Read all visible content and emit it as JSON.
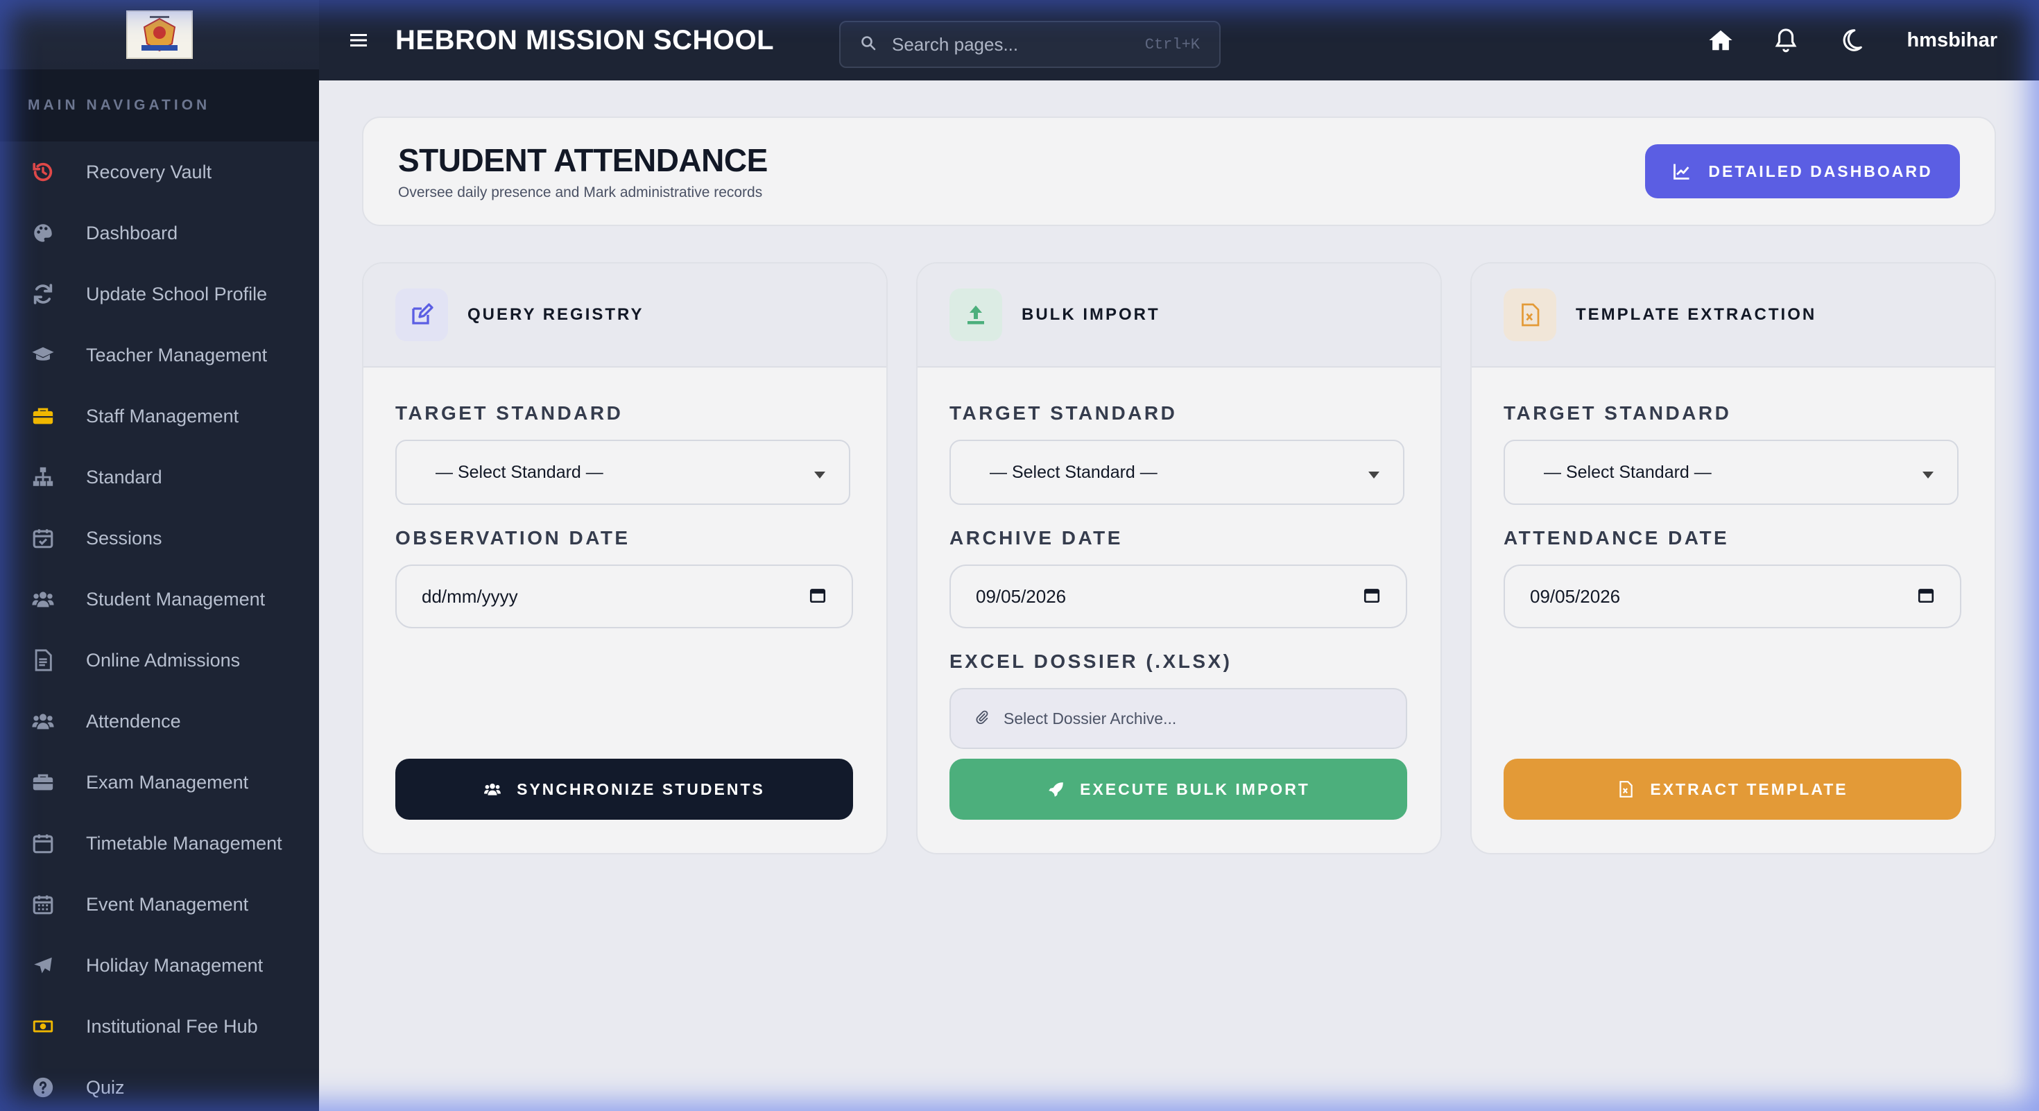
{
  "app": {
    "school_name": "HEBRON MISSION SCHOOL",
    "username": "hmsbihar"
  },
  "search": {
    "placeholder": "Search pages...",
    "shortcut": "Ctrl+K"
  },
  "sidebar": {
    "section_label": "MAIN NAVIGATION",
    "items": [
      {
        "label": "Recovery Vault",
        "icon": "history-icon",
        "color": "#e04848"
      },
      {
        "label": "Dashboard",
        "icon": "palette-icon",
        "color": "#8a93a8"
      },
      {
        "label": "Update School Profile",
        "icon": "sync-icon",
        "color": "#8a93a8"
      },
      {
        "label": "Teacher Management",
        "icon": "graduation-cap-icon",
        "color": "#8a93a8"
      },
      {
        "label": "Staff Management",
        "icon": "briefcase-icon",
        "color": "#f0b800"
      },
      {
        "label": "Standard",
        "icon": "sitemap-icon",
        "color": "#8a93a8"
      },
      {
        "label": "Sessions",
        "icon": "calendar-check-icon",
        "color": "#8a93a8"
      },
      {
        "label": "Student Management",
        "icon": "users-icon",
        "color": "#8a93a8"
      },
      {
        "label": "Online Admissions",
        "icon": "file-icon",
        "color": "#8a93a8"
      },
      {
        "label": "Attendence",
        "icon": "users-icon",
        "color": "#8a93a8"
      },
      {
        "label": "Exam Management",
        "icon": "briefcase-icon",
        "color": "#8a93a8"
      },
      {
        "label": "Timetable Management",
        "icon": "calendar-icon",
        "color": "#8a93a8"
      },
      {
        "label": "Event Management",
        "icon": "calendar-days-icon",
        "color": "#8a93a8"
      },
      {
        "label": "Holiday Management",
        "icon": "plane-icon",
        "color": "#8a93a8"
      },
      {
        "label": "Institutional Fee Hub",
        "icon": "money-bill-icon",
        "color": "#f0b800"
      },
      {
        "label": "Quiz",
        "icon": "question-circle-icon",
        "color": "#8a93a8"
      }
    ]
  },
  "page": {
    "title": "STUDENT ATTENDANCE",
    "subtitle": "Oversee daily presence and Mark administrative records",
    "dashboard_button": "DETAILED DASHBOARD"
  },
  "cards": {
    "query": {
      "title": "QUERY REGISTRY",
      "standard_label": "TARGET STANDARD",
      "standard_value": "— Select Standard —",
      "date_label": "OBSERVATION DATE",
      "date_value": "dd/mm/yyyy",
      "button": "SYNCHRONIZE STUDENTS",
      "accent": "#5b5ee3",
      "button_color": "#121a2b"
    },
    "bulk": {
      "title": "BULK IMPORT",
      "standard_label": "TARGET STANDARD",
      "standard_value": "— Select Standard —",
      "date_label": "ARCHIVE DATE",
      "date_value": "09/05/2026",
      "file_label": "EXCEL DOSSIER (.XLSX)",
      "file_placeholder": "Select Dossier Archive...",
      "button": "EXECUTE BULK IMPORT",
      "accent": "#4caf7c",
      "button_color": "#4caf7c"
    },
    "template": {
      "title": "TEMPLATE EXTRACTION",
      "standard_label": "TARGET STANDARD",
      "standard_value": "— Select Standard —",
      "date_label": "ATTENDANCE DATE",
      "date_value": "09/05/2026",
      "button": "EXTRACT TEMPLATE",
      "accent": "#e39a37",
      "button_color": "#e39a37"
    }
  }
}
